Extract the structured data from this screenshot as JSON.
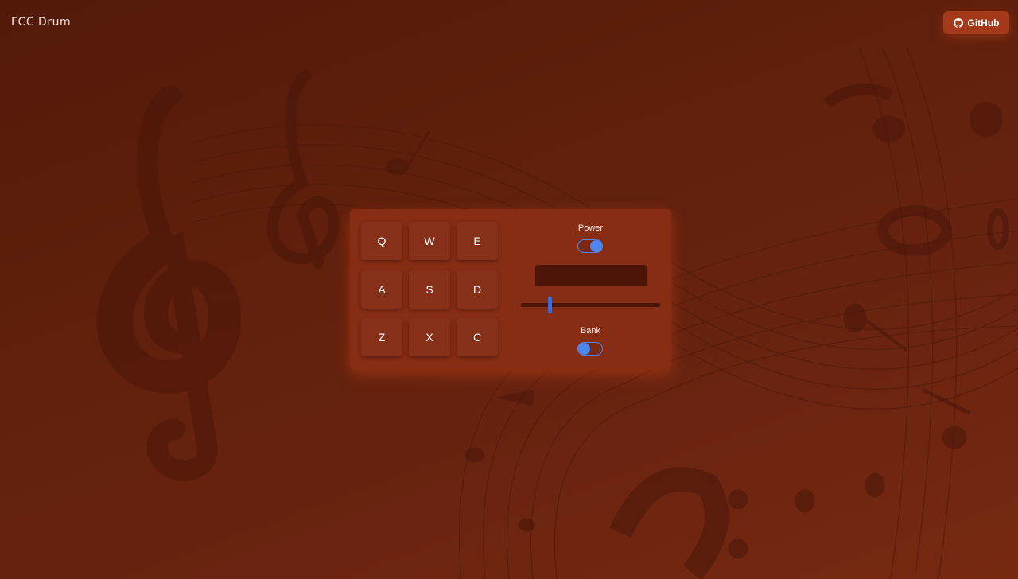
{
  "header": {
    "logo_text": "FCC Drum",
    "github_label": "GitHub",
    "github_icon": "github-icon"
  },
  "drum_machine": {
    "pads": [
      "Q",
      "W",
      "E",
      "A",
      "S",
      "D",
      "Z",
      "X",
      "C"
    ],
    "power": {
      "label": "Power",
      "on": true
    },
    "display_text": "",
    "volume": 0.2,
    "bank": {
      "label": "Bank",
      "on": false
    }
  },
  "colors": {
    "accent": "#4c87f0",
    "slider_thumb": "#2e6cf0",
    "github_button": "#a43a1a",
    "panel": "#862d14"
  }
}
